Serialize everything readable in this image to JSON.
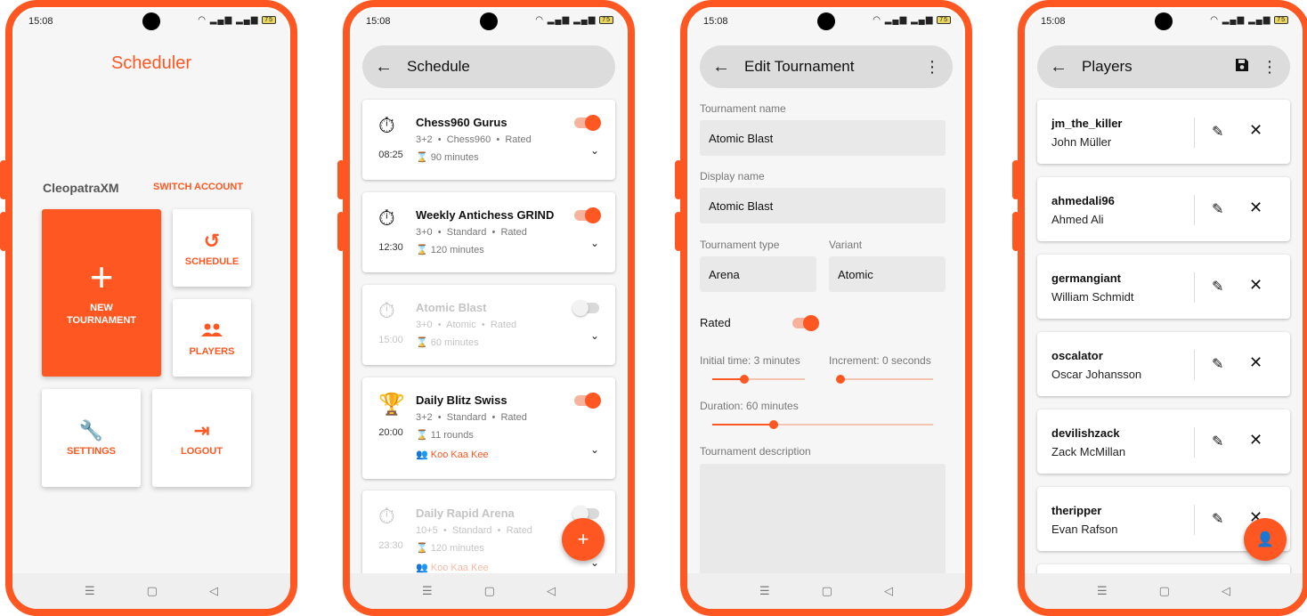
{
  "status": {
    "time": "15:08",
    "battery": "75"
  },
  "home": {
    "title": "Scheduler",
    "user": "CleopatraXM",
    "switch_account": "SWITCH ACCOUNT",
    "tiles": {
      "new_tournament": "NEW\nTOURNAMENT",
      "schedule": "SCHEDULE",
      "players": "PLAYERS",
      "settings": "SETTINGS",
      "logout": "LOGOUT"
    }
  },
  "schedule": {
    "title": "Schedule",
    "tournaments": [
      {
        "name": "Chess960 Gurus",
        "time": "08:25",
        "meta": "3+2  •  Chess960  •  Rated",
        "duration": "90 minutes",
        "team": "",
        "enabled": true,
        "icon": "timer"
      },
      {
        "name": "Weekly Antichess GRIND",
        "time": "12:30",
        "meta": "3+0  •  Standard  •  Rated",
        "duration": "120 minutes",
        "team": "",
        "enabled": true,
        "icon": "timer"
      },
      {
        "name": "Atomic Blast",
        "time": "15:00",
        "meta": "3+0  •  Atomic  •  Rated",
        "duration": "60 minutes",
        "team": "",
        "enabled": false,
        "icon": "timer"
      },
      {
        "name": "Daily Blitz Swiss",
        "time": "20:00",
        "meta": "3+2  •  Standard  •  Rated",
        "duration": "11 rounds",
        "team": "Koo Kaa Kee",
        "enabled": true,
        "icon": "trophy"
      },
      {
        "name": "Daily Rapid Arena",
        "time": "23:30",
        "meta": "10+5  •  Standard  •  Rated",
        "duration": "120 minutes",
        "team": "Koo Kaa Kee",
        "enabled": false,
        "icon": "timer"
      }
    ]
  },
  "edit": {
    "title": "Edit Tournament",
    "tournament_name_label": "Tournament name",
    "tournament_name": "Atomic Blast",
    "display_name_label": "Display name",
    "display_name": "Atomic Blast",
    "type_label": "Tournament type",
    "type": "Arena",
    "variant_label": "Variant",
    "variant": "Atomic",
    "rated_label": "Rated",
    "rated": true,
    "initial_time_label": "Initial time: 3 minutes",
    "initial_time_fraction": 0.35,
    "increment_label": "Increment: 0 seconds",
    "increment_fraction": 0.0,
    "duration_label": "Duration: 60 minutes",
    "duration_fraction": 0.28,
    "description_label": "Tournament description"
  },
  "players": {
    "title": "Players",
    "list": [
      {
        "username": "jm_the_killer",
        "name": "John Müller"
      },
      {
        "username": "ahmedali96",
        "name": "Ahmed Ali"
      },
      {
        "username": "germangiant",
        "name": "William Schmidt"
      },
      {
        "username": "oscalator",
        "name": "Oscar Johansson"
      },
      {
        "username": "devilishzack",
        "name": "Zack McMillan"
      },
      {
        "username": "theripper",
        "name": "Evan Rafson"
      }
    ]
  },
  "accent_color": "#ff5722"
}
